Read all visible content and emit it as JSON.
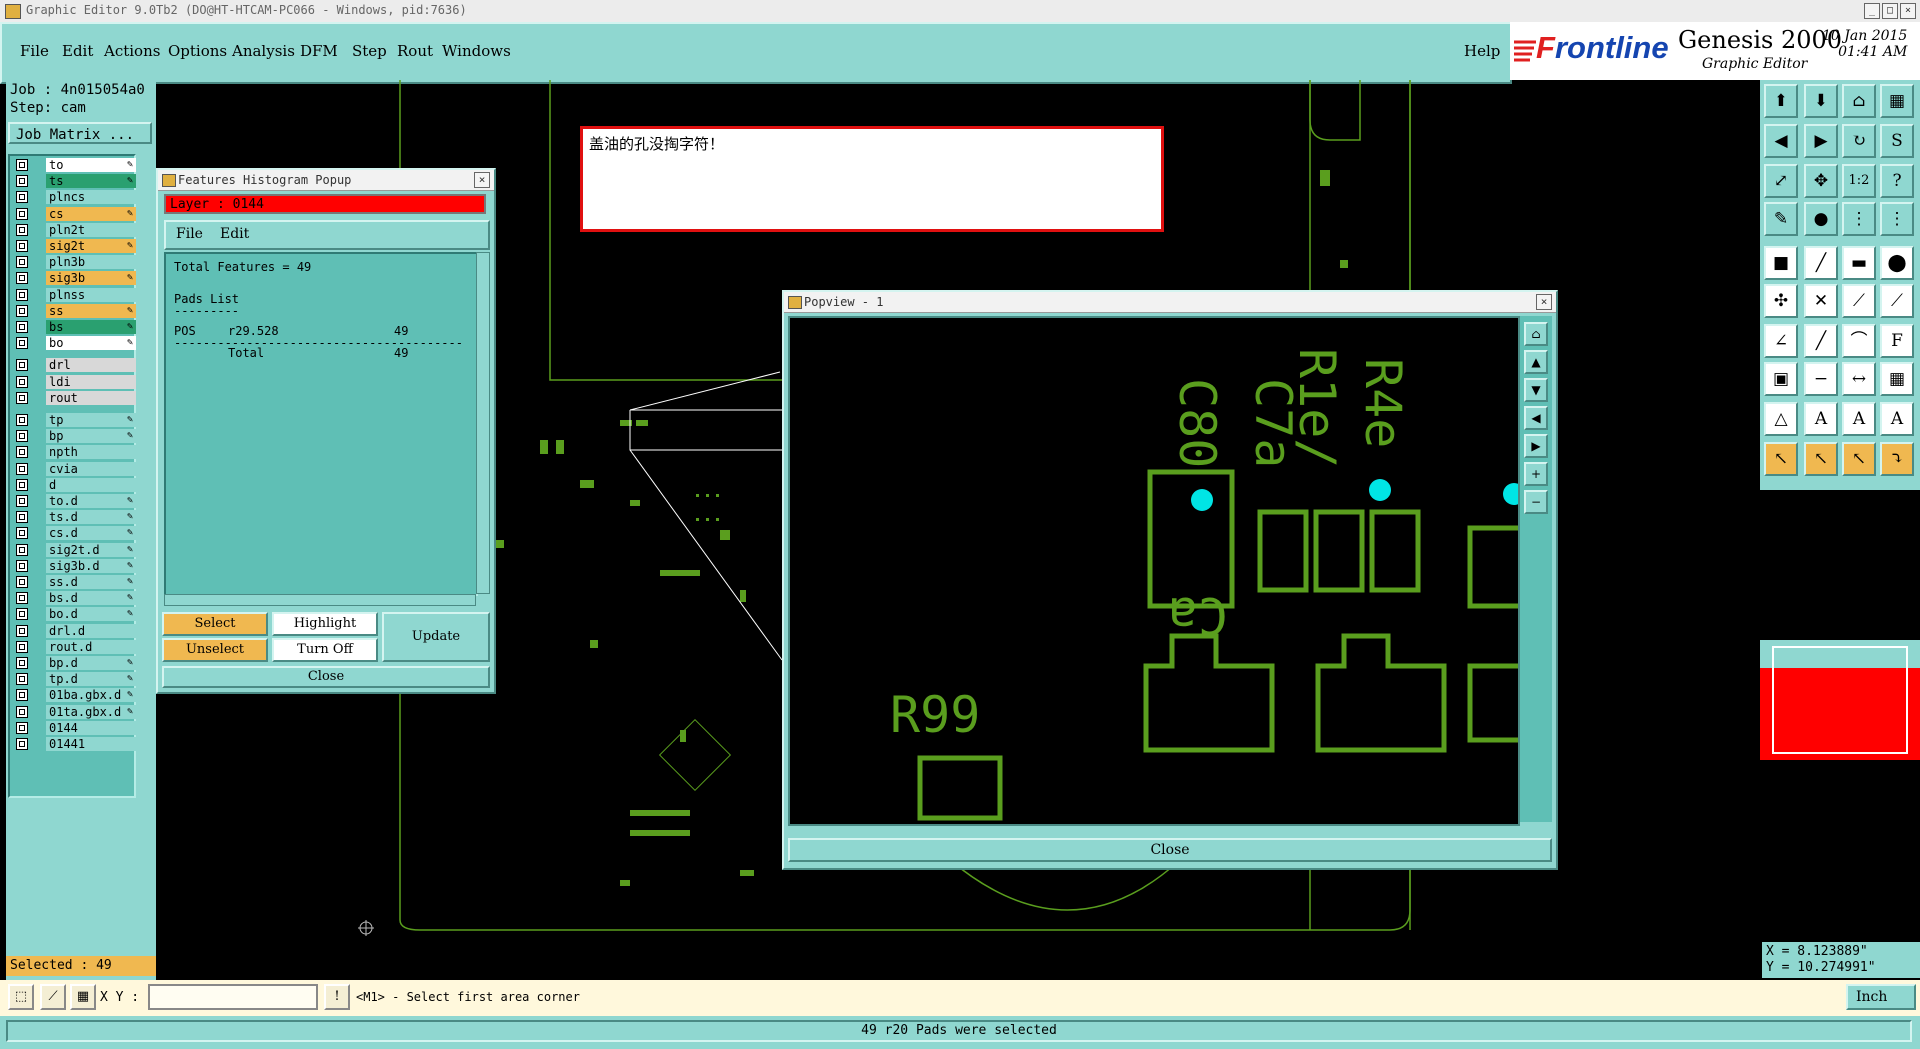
{
  "window": {
    "title": "Graphic Editor 9.0Tb2 (DO@HT-HTCAM-PC066 - Windows, pid:7636)"
  },
  "menu": [
    "File",
    "Edit",
    "Actions",
    "Options",
    "Analysis",
    "DFM",
    "Step",
    "Rout",
    "Windows"
  ],
  "help": "Help",
  "brand": {
    "logo_a": "F",
    "logo_b": "rontline",
    "product": "Genesis 2000",
    "subtitle": "Graphic Editor",
    "date": "10 Jan 2015",
    "time": "01:41 AM"
  },
  "job": {
    "name": "Job : 4n015054a0",
    "step": "Step: cam",
    "matrix": "Job Matrix ..."
  },
  "layers": [
    {
      "name": "to",
      "color": "#ffffff",
      "edit": true
    },
    {
      "name": "ts",
      "color": "#2aa070",
      "edit": true
    },
    {
      "name": "plncs",
      "color": "#8fd7d0",
      "edit": false
    },
    {
      "name": "cs",
      "color": "#f0b850",
      "edit": true
    },
    {
      "name": "pln2t",
      "color": "#8fd7d0",
      "edit": false
    },
    {
      "name": "sig2t",
      "color": "#f0b850",
      "edit": true
    },
    {
      "name": "pln3b",
      "color": "#8fd7d0",
      "edit": false
    },
    {
      "name": "sig3b",
      "color": "#f0b850",
      "edit": true
    },
    {
      "name": "plnss",
      "color": "#8fd7d0",
      "edit": false
    },
    {
      "name": "ss",
      "color": "#f0b850",
      "edit": true
    },
    {
      "name": "bs",
      "color": "#2aa070",
      "edit": true
    },
    {
      "name": "bo",
      "color": "#ffffff",
      "edit": true
    },
    {
      "name": "drl",
      "color": "#d8d8d8",
      "edit": false
    },
    {
      "name": "ldi",
      "color": "#d8d8d8",
      "edit": false
    },
    {
      "name": "rout",
      "color": "#d8d8d8",
      "edit": false
    },
    {
      "name": "tp",
      "color": "#8fd7d0",
      "edit": true
    },
    {
      "name": "bp",
      "color": "#8fd7d0",
      "edit": true
    },
    {
      "name": "npth",
      "color": "#8fd7d0",
      "edit": false
    },
    {
      "name": "cvia",
      "color": "#8fd7d0",
      "edit": false
    },
    {
      "name": "d",
      "color": "#8fd7d0",
      "edit": false
    },
    {
      "name": "to.d",
      "color": "#8fd7d0",
      "edit": true
    },
    {
      "name": "ts.d",
      "color": "#8fd7d0",
      "edit": true
    },
    {
      "name": "cs.d",
      "color": "#8fd7d0",
      "edit": true
    },
    {
      "name": "sig2t.d",
      "color": "#8fd7d0",
      "edit": true
    },
    {
      "name": "sig3b.d",
      "color": "#8fd7d0",
      "edit": true
    },
    {
      "name": "ss.d",
      "color": "#8fd7d0",
      "edit": true
    },
    {
      "name": "bs.d",
      "color": "#8fd7d0",
      "edit": true
    },
    {
      "name": "bo.d",
      "color": "#8fd7d0",
      "edit": true
    },
    {
      "name": "drl.d",
      "color": "#8fd7d0",
      "edit": false
    },
    {
      "name": "rout.d",
      "color": "#8fd7d0",
      "edit": false
    },
    {
      "name": "bp.d",
      "color": "#8fd7d0",
      "edit": true
    },
    {
      "name": "tp.d",
      "color": "#8fd7d0",
      "edit": true
    },
    {
      "name": "01ba.gbx.d",
      "color": "#8fd7d0",
      "edit": true
    },
    {
      "name": "01ta.gbx.d",
      "color": "#8fd7d0",
      "edit": true
    },
    {
      "name": "0144",
      "color": "#8fd7d0",
      "edit": false
    },
    {
      "name": "01441",
      "color": "#8fd7d0",
      "edit": false
    }
  ],
  "selected_count": "Selected : 49",
  "notice_text": "盖油的孔没掏字符！",
  "histogram": {
    "title": "Features Histogram Popup",
    "layer": "Layer :  0144",
    "menu_file": "File",
    "menu_edit": "Edit",
    "total": "Total Features = 49",
    "pads_list": "Pads List",
    "underline": "---------",
    "row_type": "POS",
    "row_symbol": "r29.528",
    "row_count": "49",
    "dashes": "----------------------------------------",
    "total_label": "Total",
    "total_count": "49",
    "select": "Select",
    "highlight": "Highlight",
    "unselect": "Unselect",
    "turn_off": "Turn Off",
    "update": "Update",
    "close": "Close"
  },
  "popview": {
    "title": "Popview - 1",
    "close": "Close",
    "labels": [
      "C80",
      "C7a",
      "R1e/",
      "R4e",
      "R99",
      "Ca"
    ]
  },
  "coords": {
    "x": "X = 8.123889\"",
    "y": "Y = 10.274991\""
  },
  "cmd": {
    "xy_label": "X Y :",
    "xy_value": "",
    "prompt": "<M1> - Select first area corner",
    "unit": "Inch"
  },
  "status": "49 r20 Pads were selected",
  "colors": {
    "teal": "#8fd7d0",
    "orange": "#f0b850",
    "pcb_green": "#5a9e1e",
    "pad_cyan": "#00e5e5",
    "alert_red": "#e01010"
  }
}
